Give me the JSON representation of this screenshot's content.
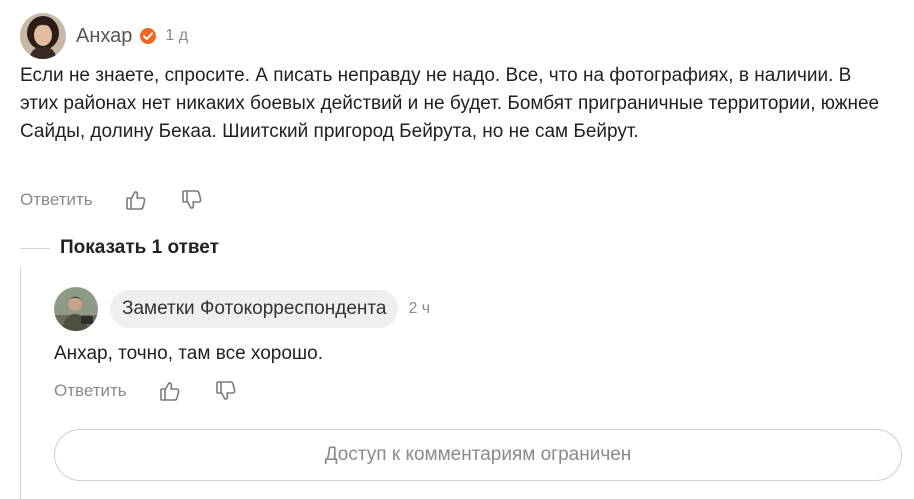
{
  "comment": {
    "author": "Анхар",
    "time": "1 д",
    "text": "Если не знаете, спросите. А писать неправду не надо. Все, что на фотографиях, в наличии. В этих районах нет никаких боевых действий и не будет. Бомбят приграничные территории, южнее Сайды, долину Бекаа. Шиитский пригород Бейрута, но не сам Бейрут.",
    "reply_label": "Ответить"
  },
  "thread": {
    "show_replies_label": "Показать 1 ответ"
  },
  "reply": {
    "author": "Заметки Фотокорреспондента",
    "time": "2 ч",
    "text": "Анхар, точно, там все хорошо.",
    "reply_label": "Ответить"
  },
  "restricted_notice": "Доступ к комментариям ограничен",
  "colors": {
    "verified_badge": "#f26522",
    "muted_text": "#8a8a8a",
    "chip_bg": "#efeff2"
  }
}
